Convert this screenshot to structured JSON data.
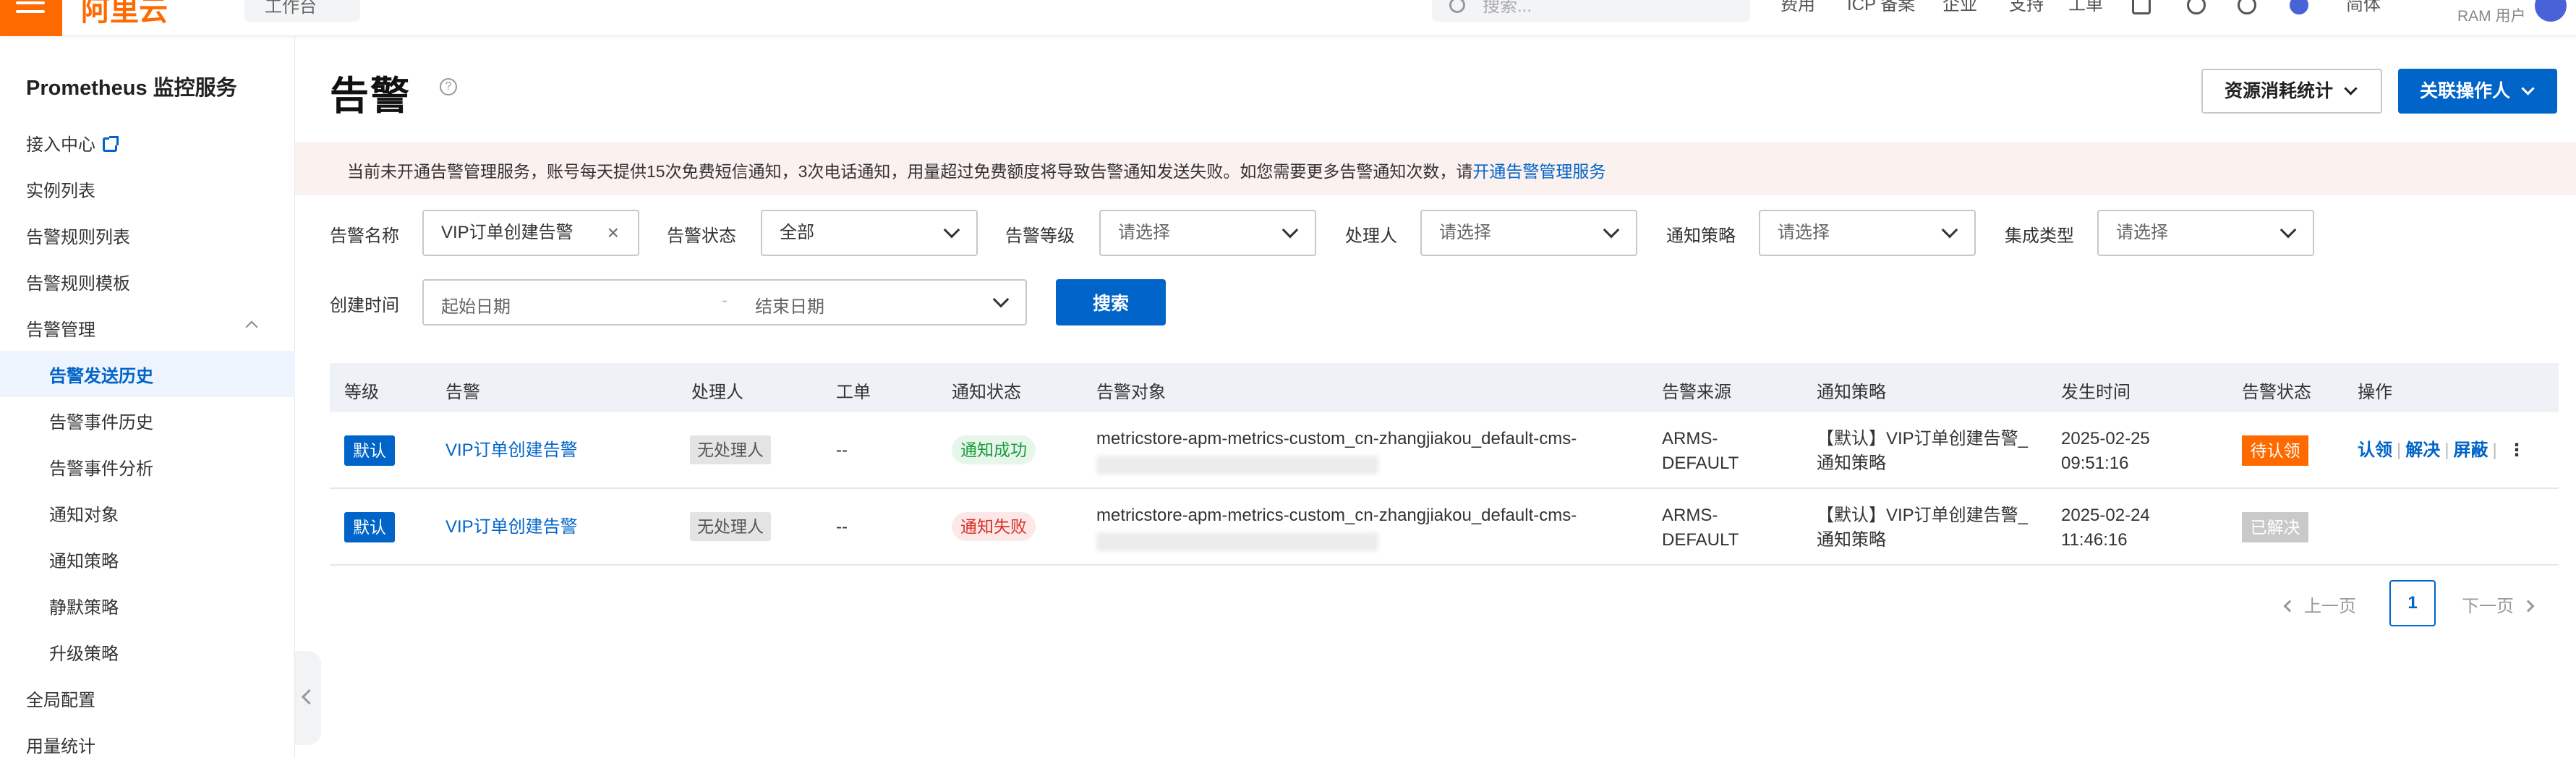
{
  "topbar": {
    "logo": "阿里云",
    "workbench": "工作台",
    "search_placeholder": "搜索...",
    "nav": [
      "费用",
      "ICP 备案",
      "企业",
      "支持",
      "工单"
    ],
    "lang": "简体",
    "ram_user": "RAM 用户"
  },
  "sidebar": {
    "title": "Prometheus 监控服务",
    "items": {
      "access_center": "接入中心",
      "instances": "实例列表",
      "alert_rules": "告警规则列表",
      "alert_templates": "告警规则模板",
      "alert_management": "告警管理",
      "send_history": "告警发送历史",
      "event_history": "告警事件历史",
      "event_analysis": "告警事件分析",
      "notify_objects": "通知对象",
      "notify_policy": "通知策略",
      "silence_policy": "静默策略",
      "escalation_policy": "升级策略",
      "global_config": "全局配置",
      "usage_stats": "用量统计"
    }
  },
  "header": {
    "title": "告警",
    "help": "?",
    "resource_btn": "资源消耗统计",
    "contact_btn": "关联操作人"
  },
  "banner": {
    "text": "当前未开通告警管理服务，账号每天提供15次免费短信通知，3次电话通知，用量超过免费额度将导致告警通知发送失败。如您需要更多告警通知次数，请",
    "link": "开通告警管理服务"
  },
  "filters": {
    "alert_name_label": "告警名称",
    "alert_name_value": "VIP订单创建告警",
    "clear": "×",
    "alert_status_label": "告警状态",
    "alert_status_value": "全部",
    "alert_level_label": "告警等级",
    "alert_level_placeholder": "请选择",
    "handler_label": "处理人",
    "handler_placeholder": "请选择",
    "notify_policy_label": "通知策略",
    "notify_policy_placeholder": "请选择",
    "integration_label": "集成类型",
    "integration_placeholder": "请选择",
    "create_time_label": "创建时间",
    "start_placeholder": "起始日期",
    "range_sep": "-",
    "end_placeholder": "结束日期",
    "search_btn": "搜索"
  },
  "table": {
    "headers": [
      "等级",
      "告警",
      "处理人",
      "工单",
      "通知状态",
      "告警对象",
      "告警来源",
      "通知策略",
      "发生时间",
      "告警状态",
      "操作"
    ],
    "rows": [
      {
        "level": "默认",
        "alert": "VIP订单创建告警",
        "handler": "无处理人",
        "ticket": "--",
        "notify_status": "通知成功",
        "object": "metricstore-apm-metrics-custom_cn-zhangjiakou_default-cms-",
        "source_1": "ARMS-",
        "source_2": "DEFAULT",
        "policy_1": "【默认】VIP订单创建告警_",
        "policy_2": "通知策略",
        "date": "2025-02-25",
        "time": "09:51:16",
        "status": "待认领",
        "ops": [
          "认领",
          "解决",
          "屏蔽"
        ],
        "more": "⋮"
      },
      {
        "level": "默认",
        "alert": "VIP订单创建告警",
        "handler": "无处理人",
        "ticket": "--",
        "notify_status": "通知失败",
        "object": "metricstore-apm-metrics-custom_cn-zhangjiakou_default-cms-",
        "source_1": "ARMS-",
        "source_2": "DEFAULT",
        "policy_1": "【默认】VIP订单创建告警_",
        "policy_2": "通知策略",
        "date": "2025-02-24",
        "time": "11:46:16",
        "status": "已解决"
      }
    ]
  },
  "pagination": {
    "prev": "上一页",
    "current": "1",
    "next": "下一页"
  },
  "colors": {
    "brand_orange": "#ff6a00",
    "primary_blue": "#0064c8",
    "success_green": "#1a9b3a",
    "error_red": "#d93026"
  }
}
